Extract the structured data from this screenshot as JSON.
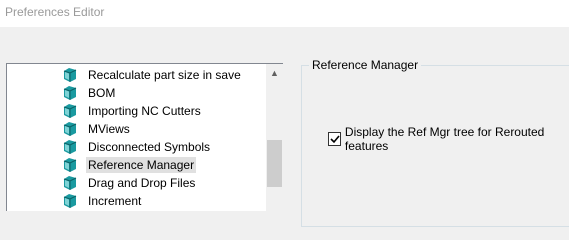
{
  "window": {
    "title": "Preferences Editor"
  },
  "tree": {
    "items": [
      {
        "label": "Recalculate part size in save",
        "selected": false
      },
      {
        "label": "BOM",
        "selected": false
      },
      {
        "label": "Importing NC Cutters",
        "selected": false
      },
      {
        "label": "MViews",
        "selected": false
      },
      {
        "label": "Disconnected Symbols",
        "selected": false
      },
      {
        "label": "Reference Manager",
        "selected": true
      },
      {
        "label": "Drag and Drop Files",
        "selected": false
      },
      {
        "label": "Increment",
        "selected": false
      }
    ],
    "scroll_up_glyph": "▲"
  },
  "panel": {
    "group_title": "Reference Manager",
    "option_label": "Display the Ref Mgr tree for Rerouted features",
    "option_checked": true
  },
  "colors": {
    "icon_teal": "#1a9aa0",
    "selection": "#e0e0e0"
  }
}
